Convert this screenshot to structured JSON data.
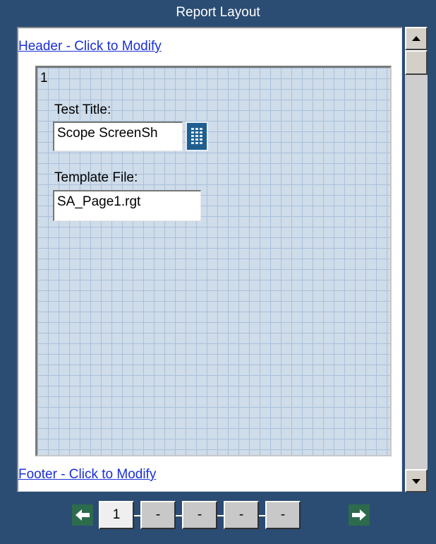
{
  "window": {
    "title": "Report Layout"
  },
  "header": {
    "link_label": "Header - Click to Modify"
  },
  "footer": {
    "link_label": "Footer - Click to Modify"
  },
  "page": {
    "number": "1",
    "fields": {
      "test_title": {
        "label": "Test Title:",
        "value": "Scope ScreenSh"
      },
      "template_file": {
        "label": "Template File:",
        "value": "SA_Page1.rgt"
      }
    }
  },
  "scrollbar": {
    "up_icon": "arrow-up-icon",
    "down_icon": "arrow-down-icon"
  },
  "pagination": {
    "prev_icon": "arrow-left-icon",
    "next_icon": "arrow-right-icon",
    "pages": [
      "1",
      "-",
      "-",
      "-",
      "-"
    ],
    "active_index": 0
  },
  "colors": {
    "background": "#2b4c73",
    "grid": "#cfdcea",
    "link": "#1a2fd6",
    "nav_arrow": "#2d6b4d",
    "keypad_button": "#1f5e8f"
  }
}
